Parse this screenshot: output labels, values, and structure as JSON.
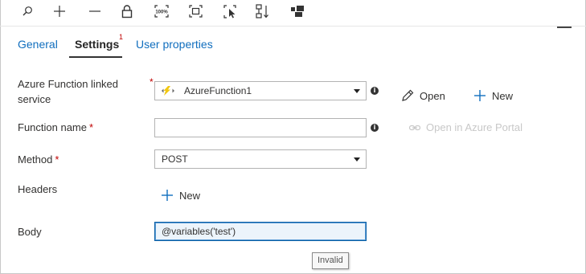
{
  "toolbar": {
    "icons": [
      "search-icon",
      "add-icon",
      "minus-icon",
      "lock-icon",
      "zoom-100-icon",
      "fit-to-window-icon",
      "select-icon",
      "arrange-icon",
      "layout-icon"
    ],
    "zoom_label": "100%"
  },
  "tabs": [
    {
      "label": "General",
      "active": false
    },
    {
      "label": "Settings",
      "active": true,
      "badge": "1"
    },
    {
      "label": "User properties",
      "active": false
    }
  ],
  "form": {
    "linked_service": {
      "label": "Azure Function linked service",
      "required": "*",
      "value": "AzureFunction1",
      "icon": "lightning-icon",
      "actions": {
        "open": "Open",
        "new": "New"
      }
    },
    "function_name": {
      "label": "Function name",
      "required": "*",
      "value": "",
      "action": "Open in Azure Portal"
    },
    "method": {
      "label": "Method",
      "required": "*",
      "value": "POST"
    },
    "headers": {
      "label": "Headers",
      "new": "New"
    },
    "body": {
      "label": "Body",
      "value": "@variables('test')",
      "tooltip": "Invalid"
    }
  },
  "colors": {
    "accent": "#106ebe",
    "required": "#c00000",
    "disabled": "#c8c8c8",
    "active_border": "#0a5fa5"
  }
}
